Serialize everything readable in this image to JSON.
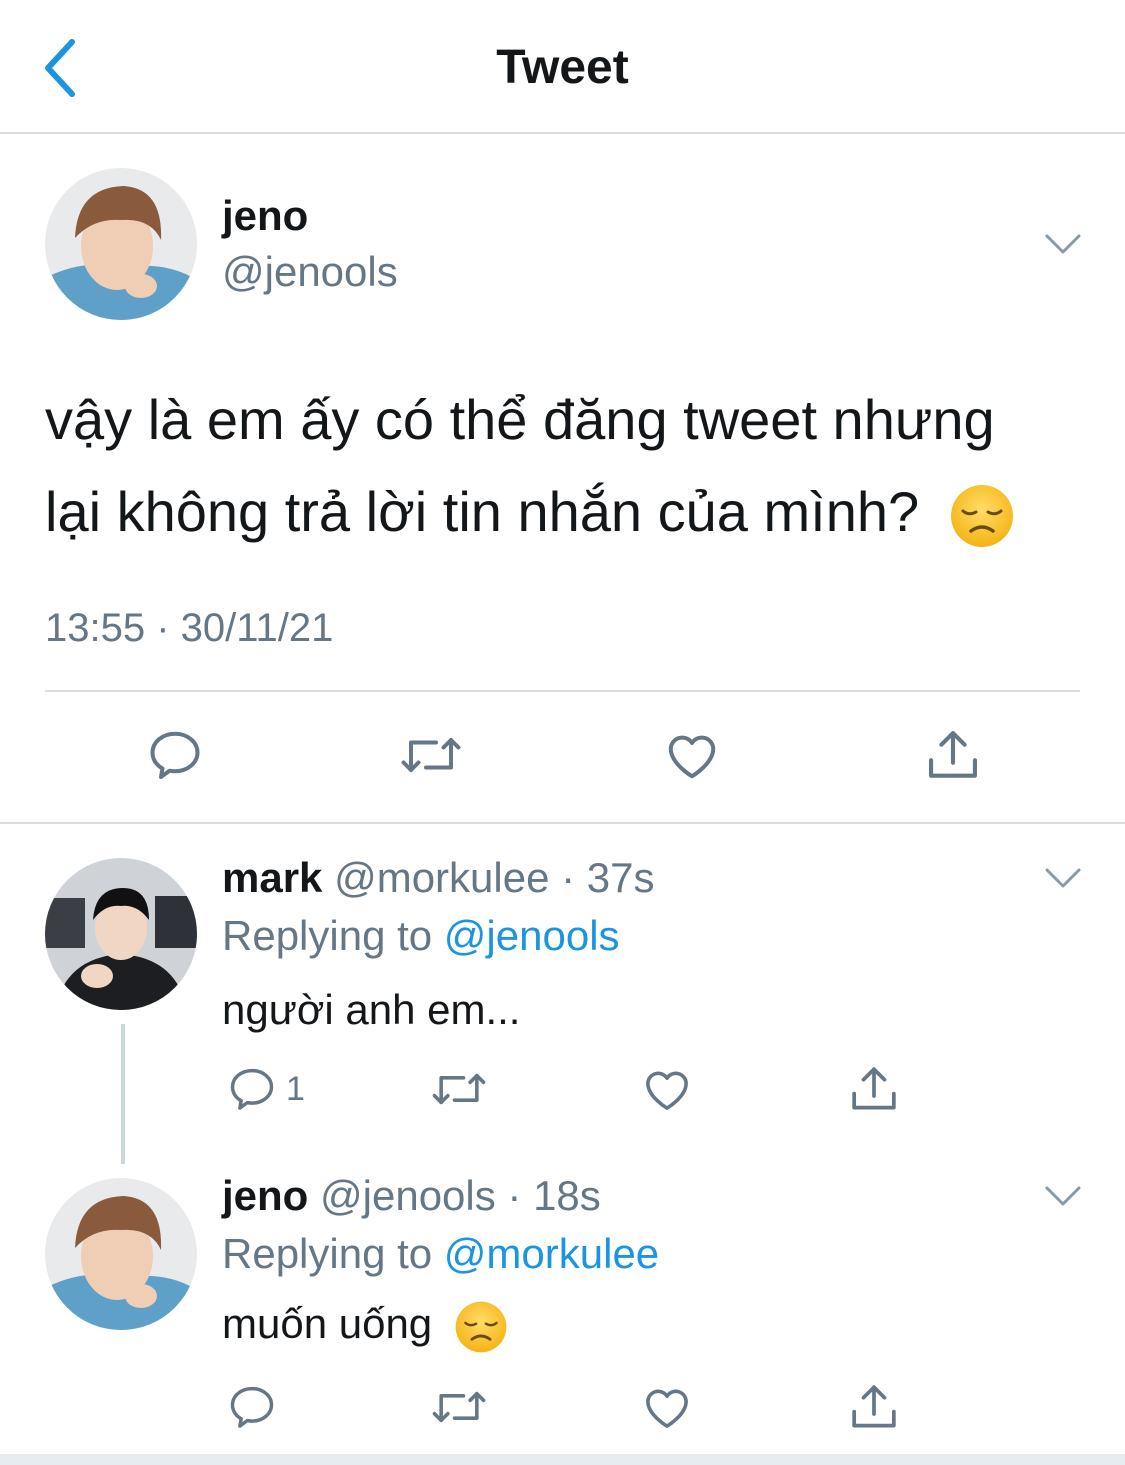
{
  "header": {
    "title": "Tweet"
  },
  "main_tweet": {
    "name": "jeno",
    "handle": "@jenools",
    "text_line1": "vậy là em ấy có thể đăng tweet nhưng",
    "text_line2": "lại không trả lời tin nhắn của mình?",
    "emoji": "disappointed-face",
    "timestamp": "13:55 · 30/11/21"
  },
  "replies": [
    {
      "name": "mark",
      "handle": "@morkulee",
      "time": "· 37s",
      "replying_prefix": "Replying to",
      "replying_to": "@jenools",
      "text": "người anh em...",
      "reply_count": "1"
    },
    {
      "name": "jeno",
      "handle": "@jenools",
      "time": "· 18s",
      "replying_prefix": "Replying to",
      "replying_to": "@morkulee",
      "text": "muốn uống",
      "emoji": "disappointed-face"
    }
  ],
  "colors": {
    "accent": "#1b95e0",
    "muted": "#657786",
    "divider": "#d9dee2",
    "icon": "#657786"
  },
  "icons": [
    "chevron-left-icon",
    "chevron-down-icon",
    "reply-icon",
    "retweet-icon",
    "like-icon",
    "share-icon"
  ]
}
